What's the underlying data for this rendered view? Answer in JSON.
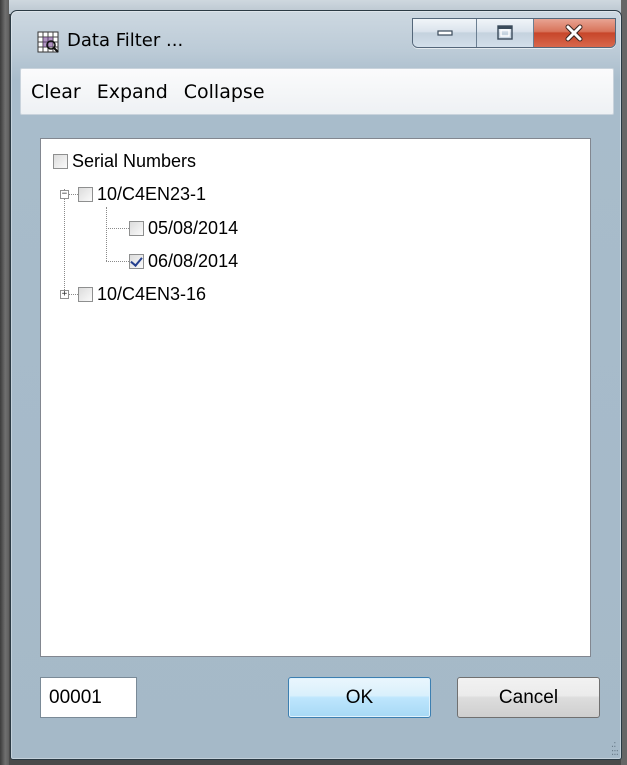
{
  "window": {
    "title": "Data Filter ...",
    "icon": "filter-grid-icon",
    "controls": {
      "minimize": "minimize-icon",
      "maximize": "maximize-icon",
      "close": "close-icon"
    }
  },
  "menu": {
    "items": [
      {
        "label": "Clear"
      },
      {
        "label": "Expand"
      },
      {
        "label": "Collapse"
      }
    ]
  },
  "tree": {
    "root": {
      "label": "Serial Numbers",
      "checked": false
    },
    "nodes": [
      {
        "label": "10/C4EN23-1",
        "checked": false,
        "expanded": true,
        "children": [
          {
            "label": "05/08/2014",
            "checked": false
          },
          {
            "label": "06/08/2014",
            "checked": true
          }
        ]
      },
      {
        "label": "10/C4EN3-16",
        "checked": false,
        "expanded": false,
        "children": []
      }
    ]
  },
  "footer": {
    "count": "00001",
    "ok_label": "OK",
    "cancel_label": "Cancel"
  },
  "colors": {
    "frame": "#a8bccb",
    "ok_accent": "#3c7fb1",
    "close_red": "#c7462a"
  }
}
